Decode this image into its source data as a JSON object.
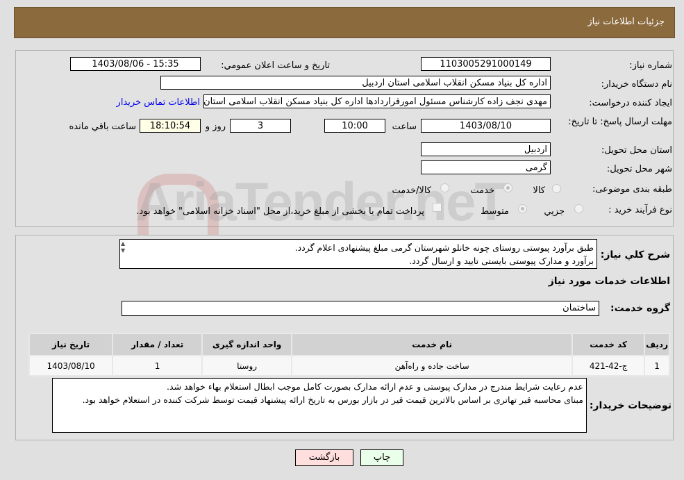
{
  "header": {
    "title": "جزئیات اطلاعات نیاز"
  },
  "form": {
    "need_number_label": "شماره نیاز:",
    "need_number": "1103005291000149",
    "announce_label": "تاریخ و ساعت اعلان عمومي:",
    "announce_value": "1403/08/06 - 15:35",
    "buyer_label": "نام دستگاه خریدار:",
    "buyer_value": "اداره کل بنیاد مسکن انقلاب اسلامی استان اردبیل",
    "creator_label": "ایجاد کننده درخواست:",
    "creator_value": "مهدی نجف زاده کارشناس مسئول امورقراردادها اداره کل بنیاد مسکن انقلاب اسلامی استان اردبیل",
    "contact_link": "اطلاعات تماس خریدار",
    "deadline_label": "مهلت ارسال پاسخ: تا تاریخ:",
    "deadline_date": "1403/08/10",
    "time_label": "ساعت",
    "deadline_time": "10:00",
    "days": "3",
    "days_label": "روز و",
    "remaining": "18:10:54",
    "remaining_label": "ساعت باقي مانده",
    "province_label": "استان محل تحویل:",
    "province": "اردبیل",
    "city_label": "شهر محل تحویل:",
    "city": "گرمی",
    "category_label": "طبقه بندی موضوعی:",
    "category_options": [
      "کالا",
      "خدمت",
      "کالا/خدمت"
    ],
    "category_selected": "خدمت",
    "process_label": "نوع فرآیند خرید :",
    "process_options": [
      "جزيي",
      "متوسط"
    ],
    "process_selected": "متوسط",
    "payment_text": "پرداخت تمام یا بخشی از مبلغ خرید،از محل \"اسناد خزانه اسلامی\" خواهد بود.",
    "payment_checked": false
  },
  "watermark": "AriaTender.neT",
  "description": {
    "label": "شرح كلي نياز:",
    "lines": [
      "طبق برآورد پیوستی روستای چونه خانلو شهرستان گرمی مبلغ پیشنهادی اعلام گردد.",
      "برآورد و مدارک پیوستی بایستی تایید و ارسال گردد."
    ]
  },
  "services": {
    "title": "اطلاعات خدمات مورد نياز",
    "group_label": "گروه خدمت:",
    "group_value": "ساختمان",
    "columns": [
      "رديف",
      "كد خدمت",
      "نام خدمت",
      "واحد اندازه گيری",
      "تعداد / مقدار",
      "تاريخ نياز"
    ],
    "rows": [
      [
        "1",
        "ج-42-421",
        "ساخت جاده و راه‌آهن",
        "روستا",
        "1",
        "1403/08/10"
      ]
    ]
  },
  "buyer_notes": {
    "label": "توضيحات خريدار:",
    "lines": [
      "عدم رعایت شرایط مندرج در مدارک پیوستی و عدم ارائه مدارک بصورت کامل موجب ابطال استعلام بهاء خواهد شد.",
      "مبنای محاسبه قیر تهاتری بر اساس بالاترین قیمت قیر در بازار بورس به تاریخ ارائه پیشنهاد قیمت توسط شرکت کننده در استعلام خواهد بود."
    ]
  },
  "buttons": {
    "print": "چاپ",
    "back": "بازگشت"
  },
  "colors": {
    "header": "#8b6a3e",
    "link": "#0000ee",
    "print_bg": "#eaffea",
    "back_bg": "#ffdede",
    "remaining_bg": "#ffffe8"
  }
}
